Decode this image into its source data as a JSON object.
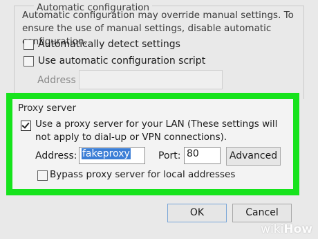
{
  "auto_config": {
    "title": "Automatic configuration",
    "description": "Automatic configuration may override manual settings.  To ensure the use of manual settings, disable automatic configuration.",
    "detect_label": "Automatically detect settings",
    "detect_checked": false,
    "script_label": "Use automatic configuration script",
    "script_checked": false,
    "address_label": "Address",
    "address_value": ""
  },
  "proxy": {
    "title": "Proxy server",
    "use_proxy_label": "Use a proxy server for your LAN (These settings will not apply to dial-up or VPN connections).",
    "use_proxy_checked": true,
    "address_label": "Address:",
    "address_value": "fakeproxy",
    "port_label": "Port:",
    "port_value": "80",
    "advanced_label": "Advanced",
    "bypass_label": "Bypass proxy server for local addresses",
    "bypass_checked": false
  },
  "footer": {
    "ok_label": "OK",
    "cancel_label": "Cancel"
  },
  "highlight_color": "#16e31c",
  "watermark": {
    "prefix": "wiki",
    "suffix": "How"
  }
}
